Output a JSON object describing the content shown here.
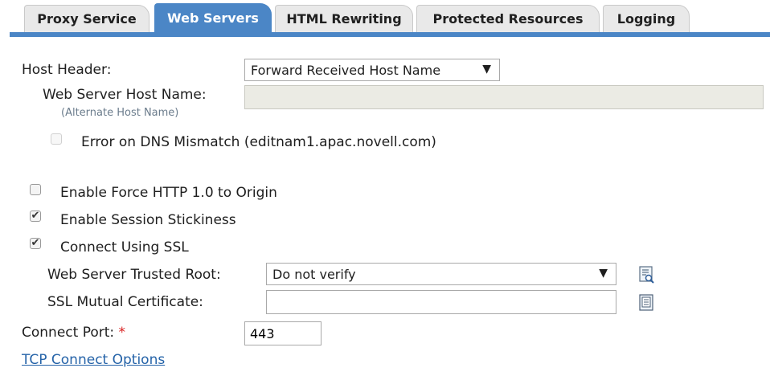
{
  "tabs": [
    {
      "label": "Proxy Service",
      "active": false
    },
    {
      "label": "Web Servers",
      "active": true
    },
    {
      "label": "HTML Rewriting",
      "active": false
    },
    {
      "label": "Protected Resources",
      "active": false
    },
    {
      "label": "Logging",
      "active": false
    }
  ],
  "host_header": {
    "label": "Host Header:",
    "value": "Forward Received Host Name"
  },
  "web_server_host_name": {
    "label": "Web Server Host Name:",
    "sublabel": "(Alternate Host Name)",
    "value": ""
  },
  "dns_mismatch": {
    "label": "Error on DNS Mismatch (editnam1.apac.novell.com)",
    "checked": false,
    "disabled": true
  },
  "force_http": {
    "label": "Enable Force HTTP 1.0 to Origin",
    "checked": false
  },
  "session_stickiness": {
    "label": "Enable Session Stickiness",
    "checked": true
  },
  "connect_ssl": {
    "label": "Connect Using SSL",
    "checked": true
  },
  "trusted_root": {
    "label": "Web Server Trusted Root:",
    "value": "Do not verify",
    "icon": "lookup-icon"
  },
  "mutual_cert": {
    "label": "SSL Mutual Certificate:",
    "value": "",
    "icon": "certificate-icon"
  },
  "connect_port": {
    "label": "Connect Port:",
    "required_mark": "*",
    "value": "443"
  },
  "tcp_link": {
    "label": "TCP Connect Options"
  },
  "colors": {
    "accent": "#4b86c6",
    "link": "#2563a8",
    "required": "#d92020"
  },
  "glyphs": {
    "check": "✔",
    "dropdown": "▼"
  }
}
